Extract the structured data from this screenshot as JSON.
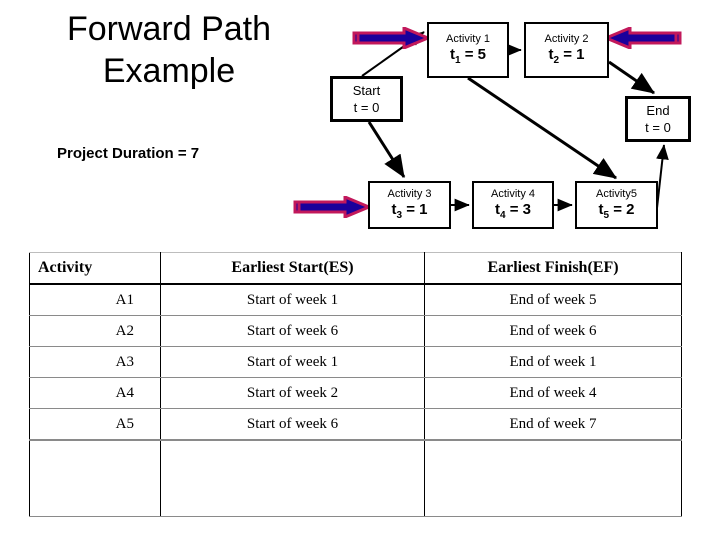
{
  "slide": {
    "title_line1": "Forward Path",
    "title_line2": "Example",
    "project_duration": "Project Duration = 7"
  },
  "colors": {
    "arrow_outline": "#c2185b",
    "arrow_fill": "#1a009b",
    "node_border": "#000000",
    "table_inner_border": "#8a8a8a",
    "table_vertical_border": "#000000"
  },
  "diagram": {
    "nodes": [
      {
        "id": "start",
        "name": "Start",
        "time": "t = 0"
      },
      {
        "id": "a1",
        "name": "Activity 1",
        "t_label": "t",
        "t_sub": "1",
        "t_value": " = 5"
      },
      {
        "id": "a2",
        "name": "Activity 2",
        "t_label": "t",
        "t_sub": "2",
        "t_value": " = 1"
      },
      {
        "id": "a3",
        "name": "Activity 3",
        "t_label": "t",
        "t_sub": "3",
        "t_value": " = 1"
      },
      {
        "id": "a4",
        "name": "Activity 4",
        "t_label": "t",
        "t_sub": "4",
        "t_value": " = 3"
      },
      {
        "id": "a5",
        "name": "Activity5",
        "t_label": "t",
        "t_sub": "5",
        "t_value": " = 2"
      },
      {
        "id": "end",
        "name": "End",
        "time": "t = 0"
      }
    ],
    "highlight_arrows": [
      {
        "id": "hl-a1",
        "direction": "right",
        "target": "Activity 1"
      },
      {
        "id": "hl-a2",
        "direction": "left",
        "target": "Activity 2"
      },
      {
        "id": "hl-a3",
        "direction": "right",
        "target": "Activity 3"
      }
    ]
  },
  "table": {
    "headers": [
      "Activity",
      "Earliest Start(ES)",
      "Earliest Finish(EF)"
    ],
    "rows": [
      [
        "A1",
        "Start of week 1",
        "End of week 5"
      ],
      [
        "A2",
        "Start of week 6",
        "End of week 6"
      ],
      [
        "A3",
        "Start of week 1",
        "End of week 1"
      ],
      [
        "A4",
        "Start of week 2",
        "End of week 4"
      ],
      [
        "A5",
        "Start of week 6",
        "End of week 7"
      ]
    ],
    "blank_row": [
      "",
      "",
      ""
    ]
  }
}
